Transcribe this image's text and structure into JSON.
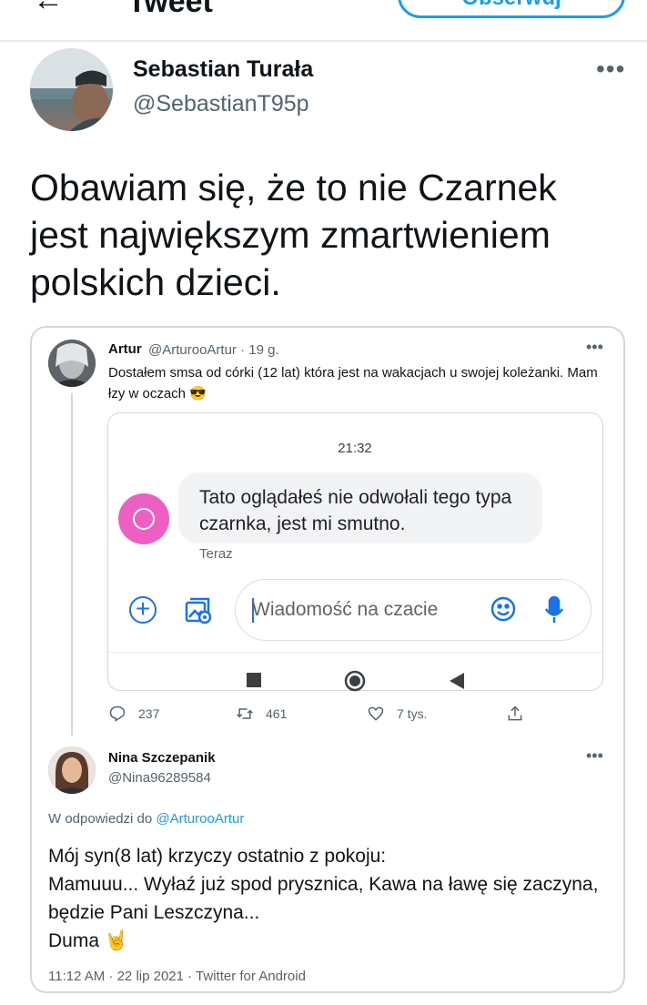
{
  "header": {
    "back_icon": "back-arrow-icon",
    "title": "Tweet",
    "follow_button": "Obserwuj"
  },
  "tweet": {
    "author_name": "Sebastian Turała",
    "author_handle": "@SebastianT95p",
    "more": "•••",
    "text": "Obawiam się, że to nie Czarnek jest największym zmartwieniem polskich dzieci."
  },
  "quote": {
    "author_name": "Artur",
    "meta": "@ArturooArtur · 19 g.",
    "more": "•••",
    "text": "Dostałem smsa od córki (12 lat) która jest na wakacjach u swojej koleżanki. Mam łzy w oczach 😎",
    "screenshot": {
      "time": "21:32",
      "message": "Tato oglądałeś nie odwołali tego typa czarnka, jest mi smutno.",
      "message_status": "Teraz",
      "input_placeholder": "Wiadomość na czacie"
    },
    "actions": {
      "replies": "237",
      "retweets": "461",
      "likes": "7 tys."
    }
  },
  "reply": {
    "author_name": "Nina Szczepanik",
    "author_handle": "@Nina96289584",
    "more": "•••",
    "reply_to_prefix": "W odpowiedzi do ",
    "reply_to_handle": "@ArturooArtur",
    "lines": [
      "Mój syn(8 lat) krzyczy ostatnio z pokoju:",
      "Mamuuu... Wyłaź już spod prysznica, Kawa na ławę się zaczyna, będzie Pani Leszczyna...",
      "Duma 🤘"
    ],
    "footer": "11:12 AM · 22 lip 2021 · Twitter for Android"
  },
  "colors": {
    "accent": "#1d9bf0",
    "sms_avatar": "#ee5fc4",
    "sms_icons": "#1a73e8"
  }
}
